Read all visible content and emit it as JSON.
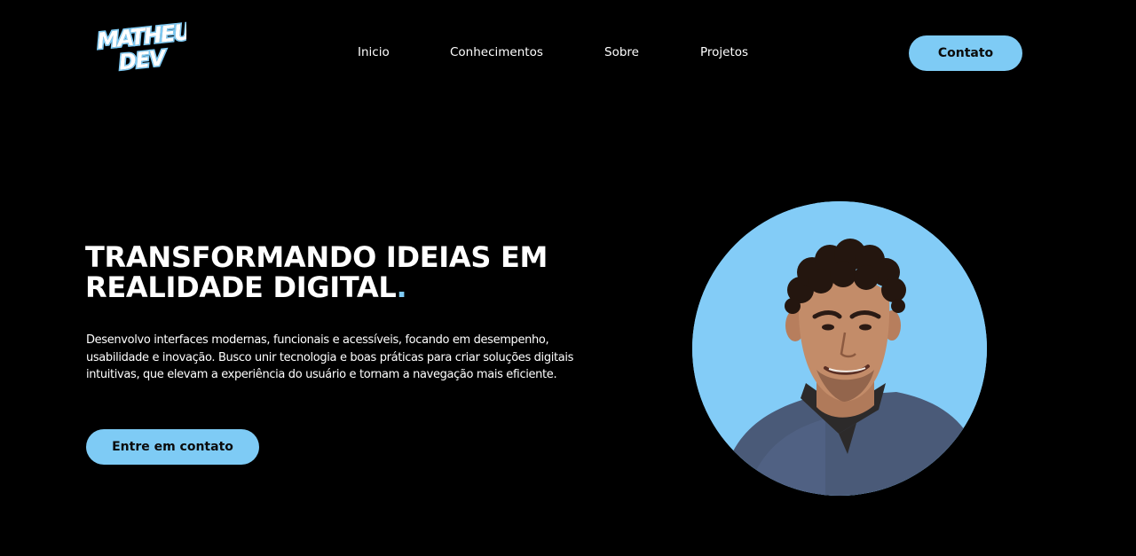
{
  "brand": {
    "logo_line1": "MATHEUS",
    "logo_line2": "DEV",
    "accent_color": "#7ecbf5"
  },
  "nav": {
    "items": [
      {
        "label": "Inicio"
      },
      {
        "label": "Conhecimentos"
      },
      {
        "label": "Sobre"
      },
      {
        "label": "Projetos"
      }
    ],
    "contact_label": "Contato"
  },
  "hero": {
    "title_line1": "TRANSFORMANDO IDEIAS EM",
    "title_line2": "REALIDADE DIGITAL",
    "title_dot": ".",
    "description": "Desenvolvo interfaces modernas, funcionais e acessíveis, focando em desempenho, usabilidade e inovação. Busco unir tecnologia e boas práticas para criar soluções digitais intuitivas, que elevam a experiência do usuário e tornam a navegação mais eficiente.",
    "cta_label": "Entre em contato"
  },
  "profile_photo": {
    "background_color": "#83ccf7"
  }
}
